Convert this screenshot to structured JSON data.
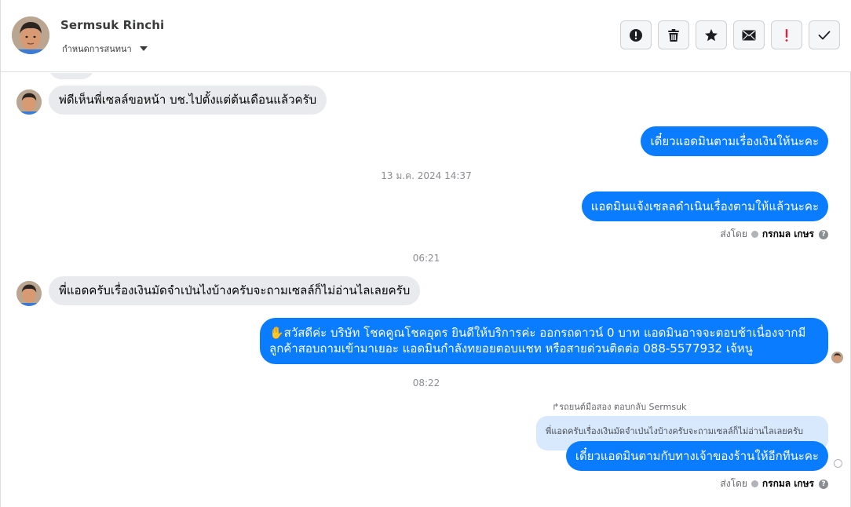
{
  "header": {
    "contact_name": "Sermsuk Rinchi",
    "sub_label": "กำหนดการสนทนา"
  },
  "actions": [
    {
      "name": "report-button",
      "icon": "alert-circle-icon"
    },
    {
      "name": "delete-button",
      "icon": "trash-icon"
    },
    {
      "name": "star-button",
      "icon": "star-icon"
    },
    {
      "name": "mark-unread-button",
      "icon": "envelope-icon"
    },
    {
      "name": "follow-up-button",
      "icon": "exclamation-icon"
    },
    {
      "name": "mark-done-button",
      "icon": "check-icon"
    }
  ],
  "messages": {
    "in_1": "พ่ดีเห็นพี่เซลล์ขอหน้า บช.ไปตั้งแต่ต้นเดือนแล้วครับ",
    "out_1": "เดี๋ยวแอดมินตามเรื่องเงินให้นะคะ",
    "time_1": "13 ม.ค. 2024 14:37",
    "out_2": "แอดมินแจ้งเซลลดำเนินเรื่องตามให้แล้วนะคะ",
    "sent_by_label_1": "ส่งโดย",
    "sent_by_agent_1": "กรกมล เกษร",
    "time_2": "06:21",
    "in_2": "พี่แอดครับเรื่องเงินมัดจำเป่นไงบ้างครับจะถามเซลล์ก็ไม่อ่านไลเลยครับ",
    "out_3_line1": "✋สวัสดีค่ะ บริษัท โชคคูณโชคอุดร ยินดีให้บริการค่ะ ออกรถดาวน์ 0 บาท แอดมินอาจจะตอบช้าเนื่องจากมี",
    "out_3_line2": "ลูกค้าสอบถามเข้ามาเยอะ แอดมินกำลังทยอยตอบแชท หรือสายด่วนติดต่อ 088-5577932 เจ้หนู",
    "time_3": "08:22",
    "reply_meta": "↱รถยนต์มือสอง ตอบกลับ Sermsuk",
    "quoted_text": "พี่แอดครับเรื่องเงินมัดจำเป่นไงบ้างครับจะถามเซลล์ก็ไม่อ่านไลเลยครับ",
    "out_4": "เดี๋ยวแอดมินตามกับทางเจ้าของร้านให้อีกทีนะคะ",
    "sent_by_label_2": "ส่งโดย",
    "sent_by_agent_2": "กรกมล เกษร"
  },
  "colors": {
    "outgoing_bubble": "#0a7cff",
    "incoming_bubble": "#e9eaed",
    "quoted_bubble": "#d8e8fd",
    "follow_up_red": "#e41e3f"
  }
}
